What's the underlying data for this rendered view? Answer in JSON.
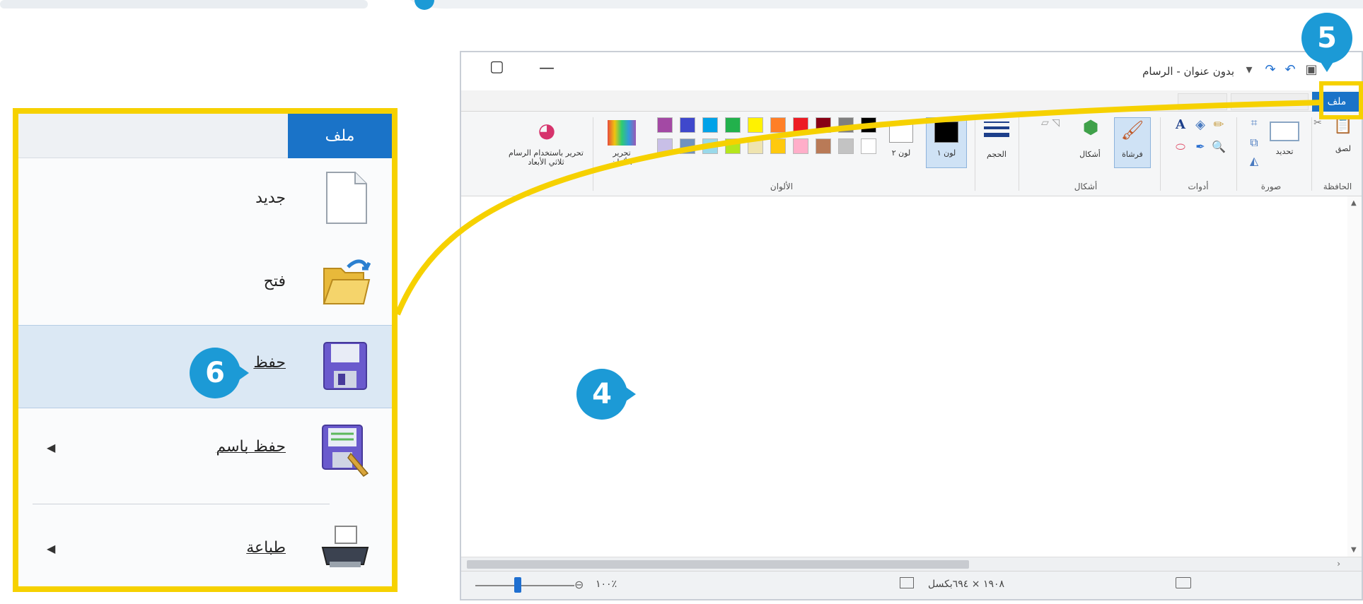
{
  "paint": {
    "title": "بدون عنوان - الرسام",
    "tab_file": "ملف",
    "groups": {
      "clipboard": "الحافظة",
      "image": "صورة",
      "tools": "أدوات",
      "shapes": "أشكال",
      "colors": "الألوان"
    },
    "buttons": {
      "paste": "لصق",
      "select": "تحديد",
      "brushes": "فرشاة",
      "shapes": "أشكال",
      "size": "الحجم",
      "color1": "لون ١",
      "color2": "لون ٢",
      "edit_colors": "تحرير الألوان",
      "paint3d": "تحرير باستخدام الرسام ثلاثي الأبعاد"
    },
    "status": {
      "zoom": "١٠٠٪",
      "dimensions": "١٩٠٨ × ٦٩٤بكسل"
    },
    "palette": [
      "#000000",
      "#7f7f7f",
      "#880015",
      "#ed1c24",
      "#ff7f27",
      "#fff200",
      "#22b14c",
      "#00a2e8",
      "#3f48cc",
      "#a349a4",
      "#ffffff",
      "#c3c3c3",
      "#b97a57",
      "#ffaec9",
      "#ffc90e",
      "#efe4b0",
      "#b5e61d",
      "#99d9ea",
      "#7092be",
      "#c8bfe7"
    ]
  },
  "file_menu": {
    "tab": "ملف",
    "items": [
      {
        "label": "جديد",
        "icon": "new-file-icon"
      },
      {
        "label": "فتح",
        "icon": "open-folder-icon"
      },
      {
        "label": "حفظ",
        "icon": "save-disk-icon"
      },
      {
        "label": "حفظ باسم",
        "icon": "save-as-icon"
      },
      {
        "label": "طباعة",
        "icon": "printer-icon"
      }
    ]
  },
  "callouts": {
    "four": "4",
    "five": "5",
    "six": "6"
  },
  "colors": {
    "accent": "#1c9ad6",
    "highlight": "#f6d100",
    "file_tab": "#1a73c8"
  }
}
